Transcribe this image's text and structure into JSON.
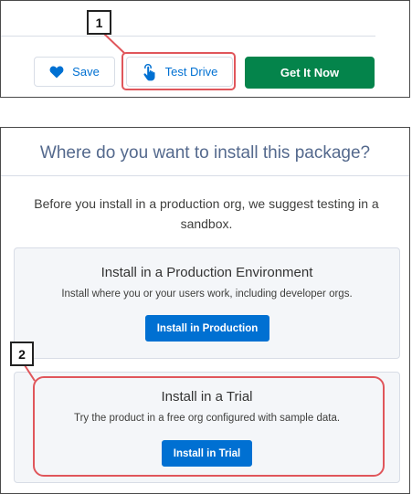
{
  "top_bar": {
    "save_label": "Save",
    "test_drive_label": "Test Drive",
    "get_it_now_label": "Get It Now"
  },
  "callouts": {
    "step1": "1",
    "step2": "2"
  },
  "dialog": {
    "title": "Where do you want to install this package?",
    "intro": "Before you install in a production org, we suggest testing in a sandbox.",
    "production": {
      "title": "Install in a Production Environment",
      "description": "Install where you or your users work, including developer orgs.",
      "button_label": "Install in Production"
    },
    "trial": {
      "title": "Install in a Trial",
      "description": "Try the product in a free org configured with sample data.",
      "button_label": "Install in Trial"
    }
  },
  "colors": {
    "brand_blue": "#0070d2",
    "green": "#04844b",
    "highlight_red": "#e0565b",
    "card_bg": "#f4f6f9"
  },
  "icons": {
    "save": "heart-icon",
    "test_drive": "touch-hand-icon"
  }
}
